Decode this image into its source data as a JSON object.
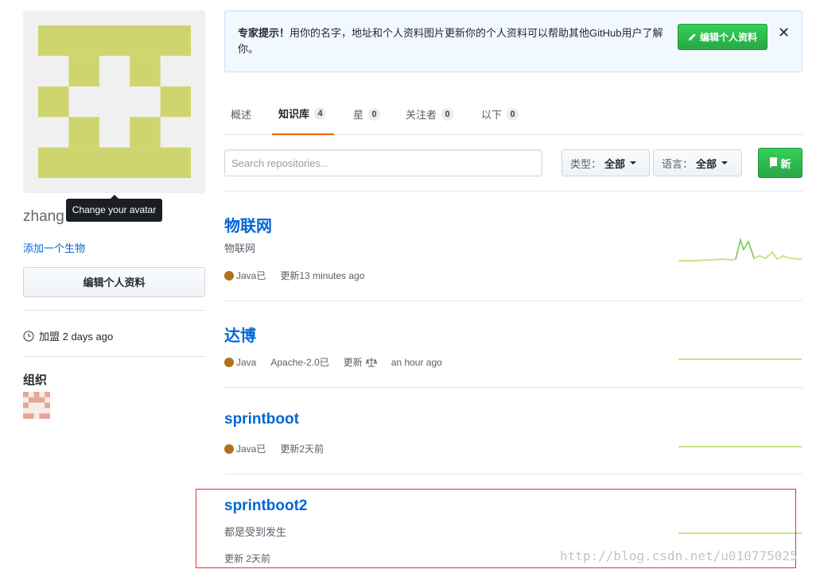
{
  "sidebar": {
    "username": "zhang",
    "avatar_tooltip": "Change your avatar",
    "add_bio": "添加一个生物",
    "edit_profile": "编辑个人资料",
    "joined": "加盟 2 days ago",
    "orgs_title": "组织"
  },
  "tip": {
    "bold": "专家提示！",
    "text": "用你的名字，地址和个人资料图片更新你的个人资料可以帮助其他GitHub用户了解你。",
    "button": "编辑个人资料",
    "close": "✕"
  },
  "tabs": [
    {
      "label": "概述",
      "count": null
    },
    {
      "label": "知识库",
      "count": "4"
    },
    {
      "label": "星",
      "count": "0"
    },
    {
      "label": "关注者",
      "count": "0"
    },
    {
      "label": "以下",
      "count": "0"
    }
  ],
  "filters": {
    "search_placeholder": "Search repositories...",
    "type_label": "类型：",
    "type_value": "全部",
    "lang_label": "语言：",
    "lang_value": "全部",
    "new_button": "新"
  },
  "repos": [
    {
      "name": "物联网",
      "description": "物联网",
      "language": "Java已",
      "license": "",
      "updated": "更新13 minutes ago"
    },
    {
      "name": "达博",
      "description": "",
      "language": "Java",
      "license": "Apache-2.0已",
      "updated_prefix": "更新",
      "updated": "an hour ago"
    },
    {
      "name": "sprintboot",
      "description": "",
      "language": "Java已",
      "license": "",
      "updated": "更新2天前"
    },
    {
      "name": "sprintboot2",
      "description": "都是受到发生",
      "language": "",
      "license": "",
      "updated": "更新 2天前"
    }
  ],
  "watermark": "http://blog.csdn.net/u010775025",
  "colors": {
    "link": "#0366d6",
    "java": "#b07219",
    "green_button": "#28a745",
    "active_tab_border": "#e36209",
    "highlight_box": "#d9373c",
    "avatar_fill": "#cfd56e"
  }
}
